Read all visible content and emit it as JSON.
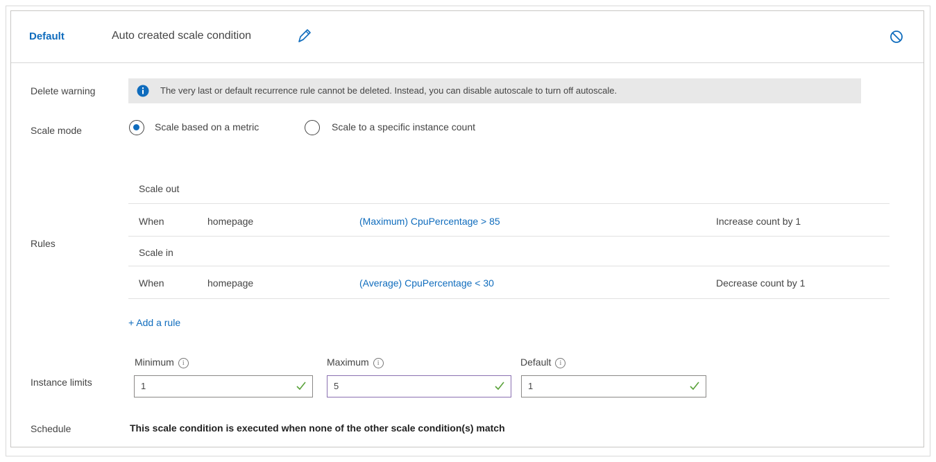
{
  "header": {
    "tab_label": "Default",
    "title": "Auto created scale condition",
    "edit_icon": "pencil-icon",
    "disable_icon": "prohibited-icon"
  },
  "delete_warning": {
    "label": "Delete warning",
    "icon": "info-icon",
    "message": "The very last or default recurrence rule cannot be deleted. Instead, you can disable autoscale to turn off autoscale."
  },
  "scale_mode": {
    "label": "Scale mode",
    "options": [
      {
        "label": "Scale based on a metric",
        "selected": true
      },
      {
        "label": "Scale to a specific instance count",
        "selected": false
      }
    ]
  },
  "rules": {
    "label": "Rules",
    "scale_out_label": "Scale out",
    "scale_in_label": "Scale in",
    "scale_out": {
      "when": "When",
      "resource": "homepage",
      "condition": "(Maximum) CpuPercentage > 85",
      "action": "Increase count by 1"
    },
    "scale_in": {
      "when": "When",
      "resource": "homepage",
      "condition": "(Average) CpuPercentage < 30",
      "action": "Decrease count by 1"
    },
    "add_rule_label": "+ Add a rule"
  },
  "instance_limits": {
    "label": "Instance limits",
    "minimum": {
      "label": "Minimum",
      "value": "1"
    },
    "maximum": {
      "label": "Maximum",
      "value": "5"
    },
    "default": {
      "label": "Default",
      "value": "1"
    }
  },
  "schedule": {
    "label": "Schedule",
    "text": "This scale condition is executed when none of the other scale condition(s) match"
  },
  "colors": {
    "accent": "#0f6cbd",
    "warning_bg": "#e8e8e8"
  }
}
